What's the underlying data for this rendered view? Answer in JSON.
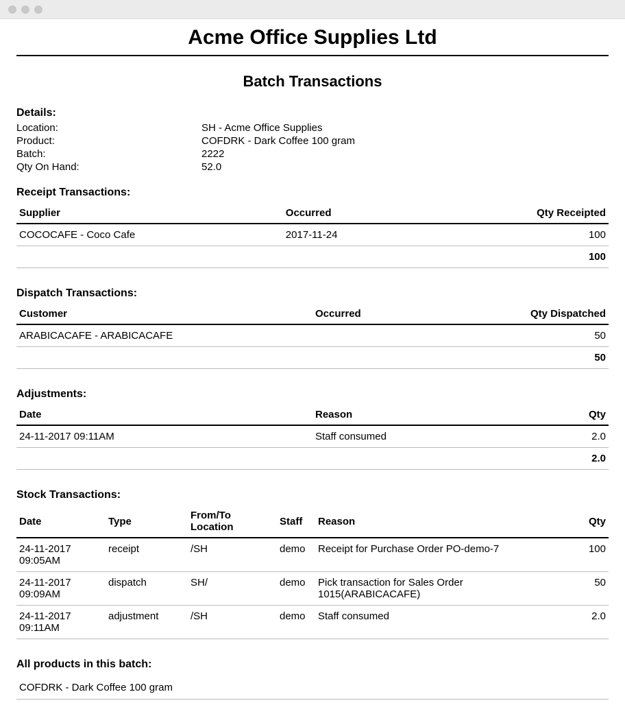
{
  "company": "Acme Office Supplies Ltd",
  "subtitle": "Batch Transactions",
  "details": {
    "heading": "Details:",
    "rows": [
      {
        "label": "Location:",
        "value": "SH - Acme Office Supplies"
      },
      {
        "label": "Product:",
        "value": "COFDRK - Dark Coffee 100 gram"
      },
      {
        "label": "Batch:",
        "value": "2222"
      },
      {
        "label": "Qty On Hand:",
        "value": "52.0"
      }
    ]
  },
  "receipt": {
    "heading": "Receipt Transactions:",
    "headers": {
      "supplier": "Supplier",
      "occurred": "Occurred",
      "qty": "Qty Receipted"
    },
    "rows": [
      {
        "supplier": "COCOCAFE - Coco Cafe",
        "occurred": "2017-11-24",
        "qty": "100"
      }
    ],
    "total": "100"
  },
  "dispatch": {
    "heading": "Dispatch Transactions:",
    "headers": {
      "customer": "Customer",
      "occurred": "Occurred",
      "qty": "Qty Dispatched"
    },
    "rows": [
      {
        "customer": "ARABICACAFE - ARABICACAFE",
        "occurred": "",
        "qty": "50"
      }
    ],
    "total": "50"
  },
  "adjustments": {
    "heading": "Adjustments:",
    "headers": {
      "date": "Date",
      "reason": "Reason",
      "qty": "Qty"
    },
    "rows": [
      {
        "date": "24-11-2017 09:11AM",
        "reason": "Staff consumed",
        "qty": "2.0"
      }
    ],
    "total": "2.0"
  },
  "stock": {
    "heading": "Stock Transactions:",
    "headers": {
      "date": "Date",
      "type": "Type",
      "loc": "From/To Location",
      "staff": "Staff",
      "reason": "Reason",
      "qty": "Qty"
    },
    "rows": [
      {
        "date": "24-11-2017 09:05AM",
        "type": "receipt",
        "loc": "/SH",
        "staff": "demo",
        "reason": "Receipt for Purchase Order PO-demo-7",
        "qty": "100"
      },
      {
        "date": "24-11-2017 09:09AM",
        "type": "dispatch",
        "loc": "SH/",
        "staff": "demo",
        "reason": "Pick transaction for Sales Order 1015(ARABICACAFE)",
        "qty": "50"
      },
      {
        "date": "24-11-2017 09:11AM",
        "type": "adjustment",
        "loc": "/SH",
        "staff": "demo",
        "reason": "Staff consumed",
        "qty": "2.0"
      }
    ]
  },
  "allProducts": {
    "heading": "All products in this batch:",
    "rows": [
      "COFDRK - Dark Coffee 100 gram"
    ]
  }
}
